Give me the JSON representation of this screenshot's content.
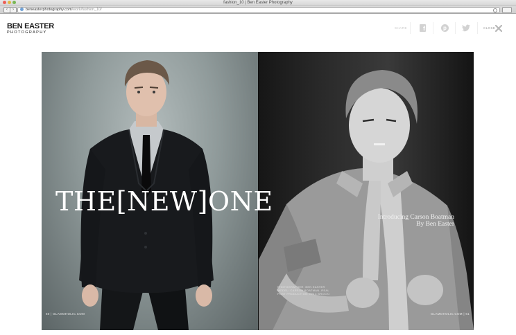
{
  "browser": {
    "window_title": "fashion_10 | Ben Easter Photography",
    "url_domain": "beneasterphotography.com",
    "url_path": "/work/fashion_10/"
  },
  "header": {
    "logo_line1": "BEN EASTER",
    "logo_line2": "PHOTOGRAPHY",
    "share_label": "SHARE",
    "close_label": "CLOSE",
    "icons": [
      "facebook-icon",
      "pinterest-icon",
      "twitter-icon",
      "close-icon"
    ]
  },
  "spread": {
    "headline": "THE[NEW]ONE",
    "subline1": "Introducing Carson Boatman",
    "subline2": "By Ben Easter",
    "folio_left": "60 | GLAMOHOLIC.COM",
    "folio_right": "GLAMOHOLIC.COM | 61",
    "credits_line1": "PHOTOGRAPHER: BEN EASTER",
    "credits_line2": "MODEL: CARSON BOATMAN, REAL",
    "credits_line3": "POST PRODUCTION: ERIC BROCKI"
  },
  "colors": {
    "left_backdrop": "#8f9a9a",
    "right_backdrop": "#2a2a2a",
    "icon_grey": "#d2d2d2"
  }
}
